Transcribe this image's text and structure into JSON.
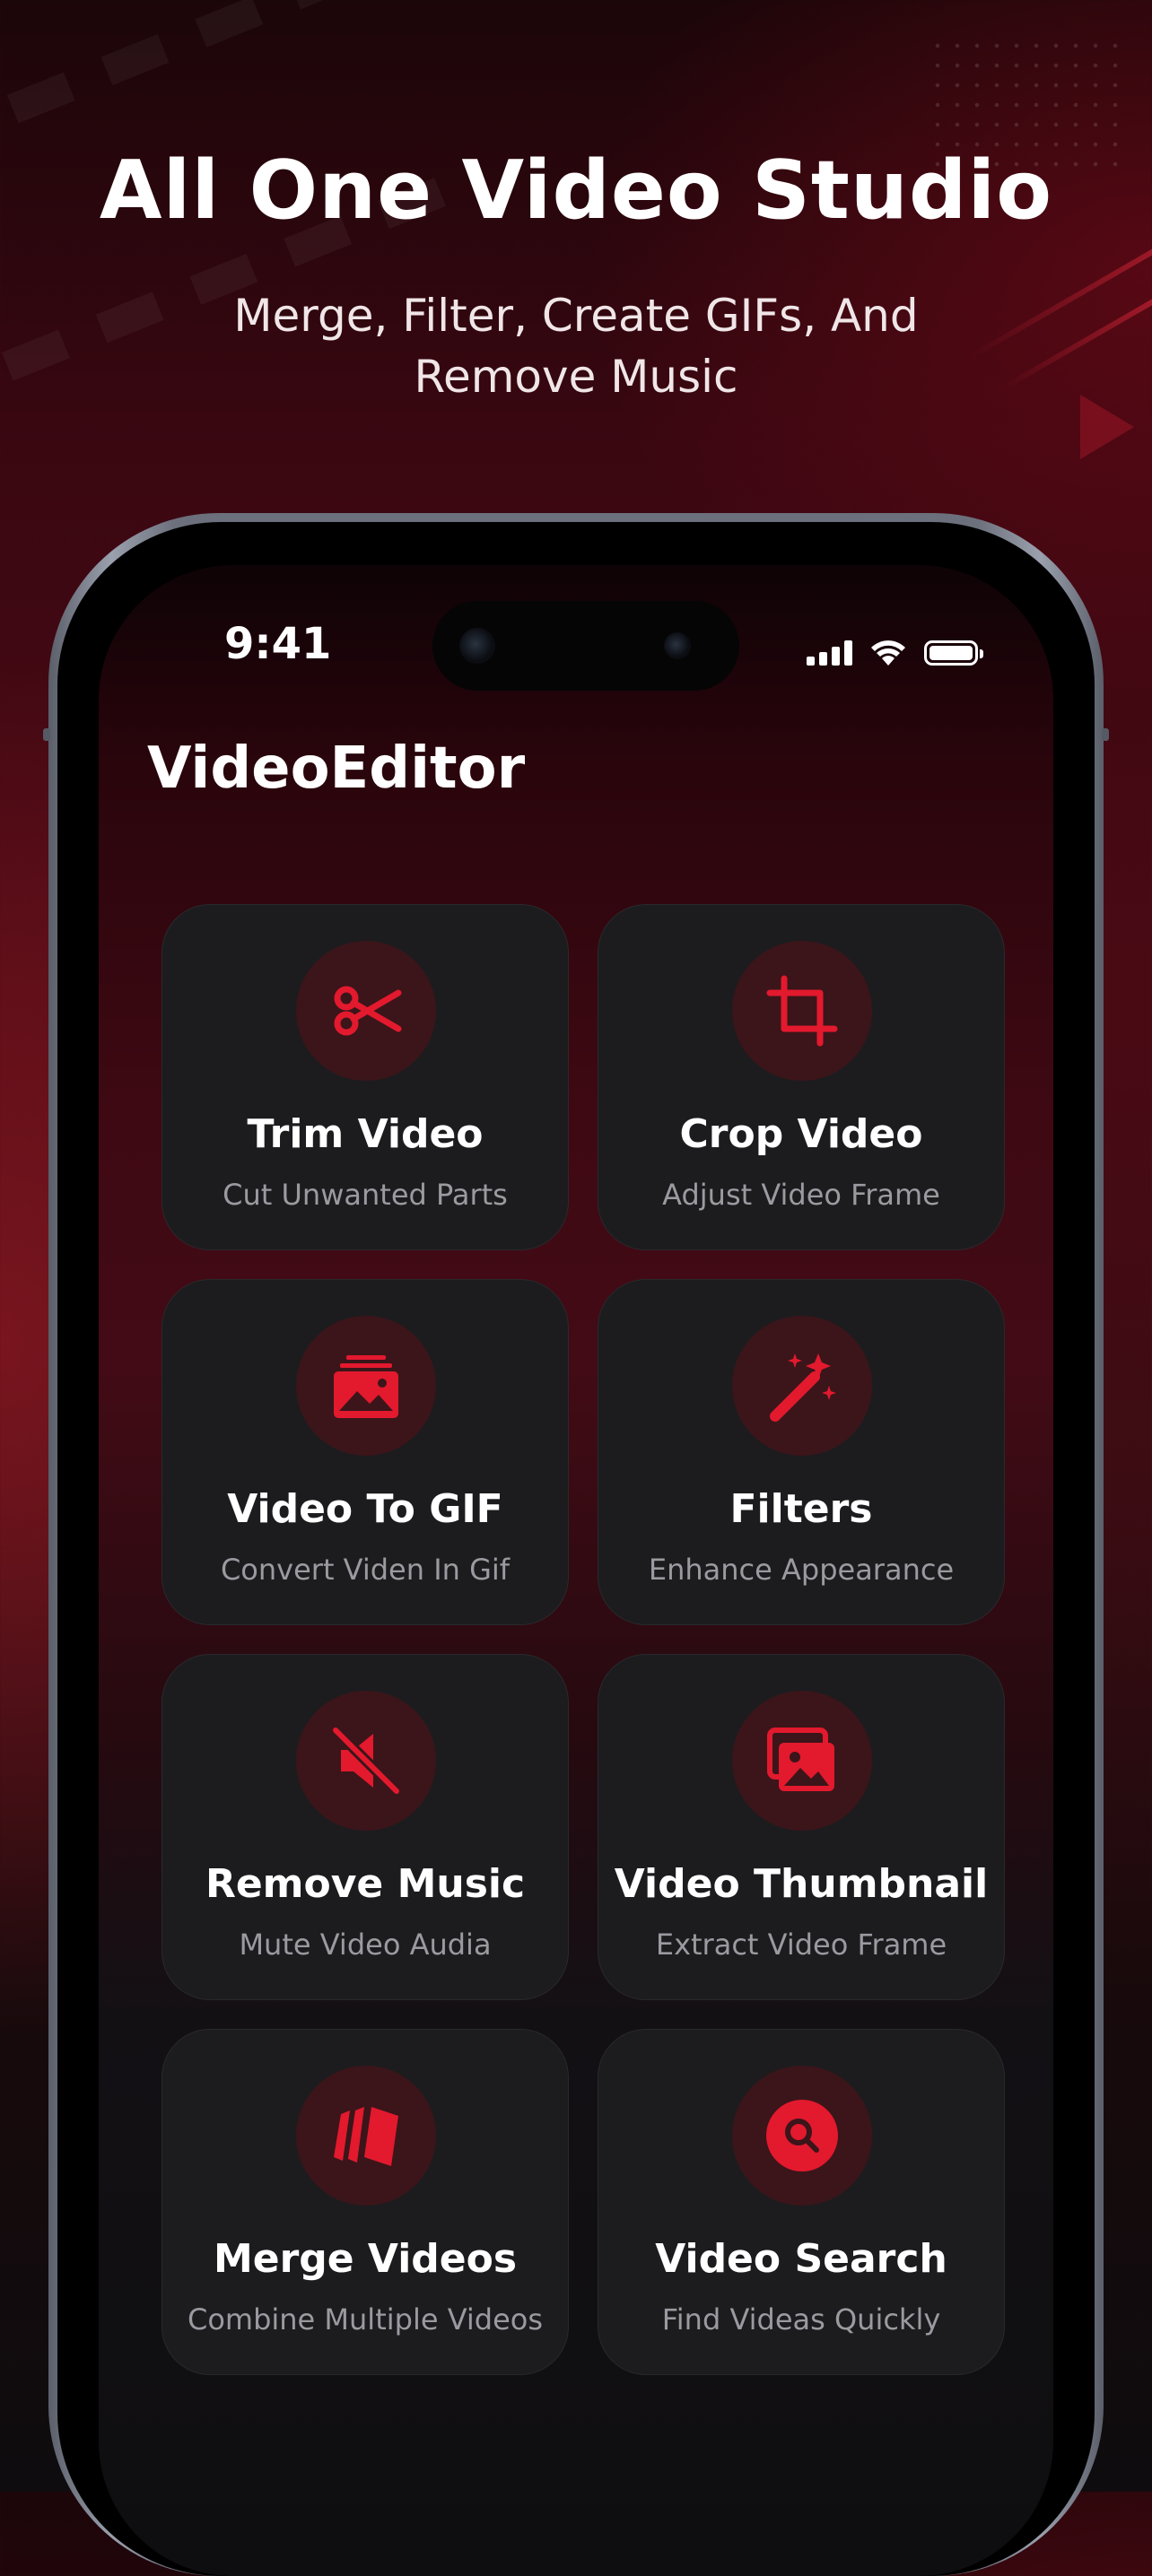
{
  "headline": "All One Video Studio",
  "subheadline": "Merge, Filter, Create GIFs, And Remove Music",
  "status_bar": {
    "time": "9:41"
  },
  "app": {
    "title": "VideoEditor"
  },
  "accent_color": "#e3192e",
  "tools": [
    {
      "icon": "scissors-icon",
      "title": "Trim Video",
      "subtitle": "Cut Unwanted Parts"
    },
    {
      "icon": "crop-icon",
      "title": "Crop Video",
      "subtitle": "Adjust Video Frame"
    },
    {
      "icon": "image-stack-icon",
      "title": "Video To GIF",
      "subtitle": "Convert Viden In Gif"
    },
    {
      "icon": "magic-wand-icon",
      "title": "Filters",
      "subtitle": "Enhance Appearance"
    },
    {
      "icon": "mute-icon",
      "title": "Remove Music",
      "subtitle": "Mute Video Audia"
    },
    {
      "icon": "gallery-icon",
      "title": "Video Thumbnail",
      "subtitle": "Extract Video Frame"
    },
    {
      "icon": "layers-icon",
      "title": "Merge Videos",
      "subtitle": "Combine Multiple Videos"
    },
    {
      "icon": "search-icon",
      "title": "Video Search",
      "subtitle": "Find Videas Quickly"
    }
  ]
}
